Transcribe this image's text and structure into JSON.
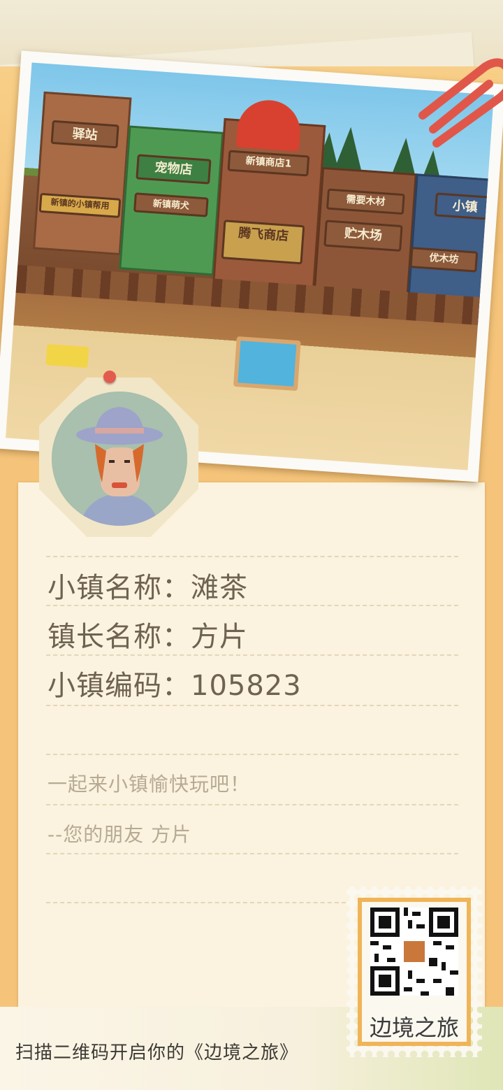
{
  "photo": {
    "signs": [
      "驿站",
      "宠物店",
      "腾飞商店",
      "新镇商店1",
      "需要木材",
      "贮木场",
      "优木坊",
      "小镇",
      "新镇萌犬",
      "新镇的小镇帮用"
    ]
  },
  "letter": {
    "town_name_label": "小镇名称：",
    "town_name_value": "滩茶",
    "mayor_label": "镇长名称：",
    "mayor_value": "方片",
    "code_label": "小镇编码：",
    "code_value": "105823",
    "message_line1": "一起来小镇愉快玩吧！",
    "message_line2": "--您的朋友  方片"
  },
  "stamp": {
    "label": "边境之旅"
  },
  "banner": {
    "text": "扫描二维码开启你的《边境之旅》"
  },
  "colors": {
    "envelope": "#f5c47a",
    "letter_bg": "#fbf3df",
    "text_main": "#6f6250",
    "text_muted": "#b7aa93",
    "stamp_border": "#f0b458",
    "clip": "#e0574a"
  }
}
